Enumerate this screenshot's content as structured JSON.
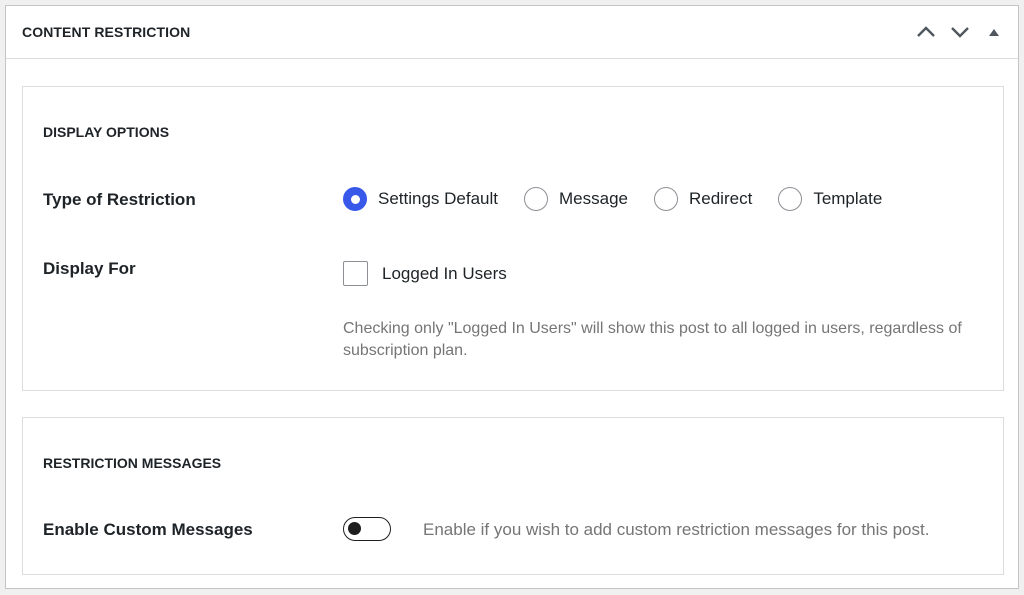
{
  "header": {
    "title": "CONTENT RESTRICTION",
    "icons": [
      "chevron-up-icon",
      "chevron-down-icon",
      "triangle-up-icon"
    ]
  },
  "display_options": {
    "title": "DISPLAY OPTIONS",
    "type_label": "Type of Restriction",
    "restriction_types": [
      {
        "label": "Settings Default",
        "checked": true
      },
      {
        "label": "Message",
        "checked": false
      },
      {
        "label": "Redirect",
        "checked": false
      },
      {
        "label": "Template",
        "checked": false
      }
    ],
    "display_for_label": "Display For",
    "logged_in_label": "Logged In Users",
    "logged_in_checked": false,
    "help_text": "Checking only \"Logged In Users\" will show this post to all logged in users, regardless of subscription plan."
  },
  "restriction_messages": {
    "title": "RESTRICTION MESSAGES",
    "enable_label": "Enable Custom Messages",
    "enabled": false,
    "enable_help": "Enable if you wish to add custom restriction messages for this post."
  },
  "colors": {
    "accent": "#3858e9",
    "border": "#c3c4c7",
    "muted_text": "#757575"
  }
}
